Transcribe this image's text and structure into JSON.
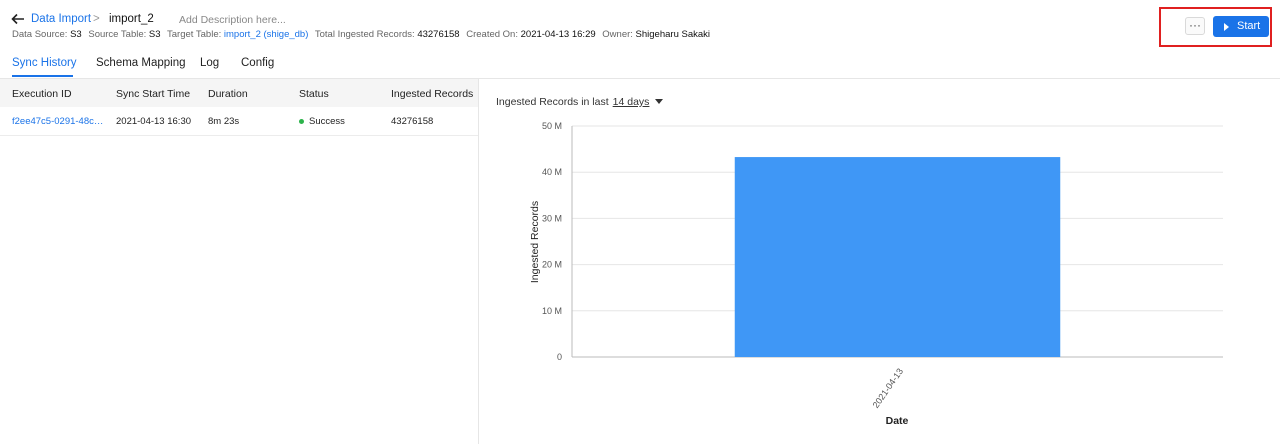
{
  "header": {
    "breadcrumb_link": "Data Import",
    "breadcrumb_sep": ">",
    "import_name": "import_2",
    "description_placeholder": "Add Description here...",
    "meta": {
      "data_source_label": "Data Source:",
      "data_source_value": "S3",
      "source_table_label": "Source Table:",
      "source_table_value": "S3",
      "target_table_label": "Target Table:",
      "target_table_value": "import_2 (shige_db)",
      "total_label": "Total Ingested Records:",
      "total_value": "43276158",
      "created_label": "Created On:",
      "created_value": "2021-04-13 16:29",
      "owner_label": "Owner:",
      "owner_value": "Shigeharu Sakaki"
    },
    "more_label": "···",
    "start_label": "Start"
  },
  "tabs": [
    {
      "label": "Sync History",
      "active": true
    },
    {
      "label": "Schema Mapping",
      "active": false
    },
    {
      "label": "Log",
      "active": false
    },
    {
      "label": "Config",
      "active": false
    }
  ],
  "table": {
    "columns": [
      "Execution ID",
      "Sync Start Time",
      "Duration",
      "Status",
      "Ingested Records"
    ],
    "rows": [
      {
        "execution_id": "f2ee47c5-0291-48c…",
        "start_time": "2021-04-13 16:30",
        "duration": "8m 23s",
        "status": "Success",
        "records": "43276158"
      }
    ]
  },
  "chart": {
    "title_prefix": "Ingested Records in last",
    "range_label": "14 days"
  },
  "chart_data": {
    "type": "bar",
    "categories": [
      "2021-04-13"
    ],
    "values": [
      43276158
    ],
    "xlabel": "Date",
    "ylabel": "Ingested Records",
    "ylim": [
      0,
      50000000
    ],
    "yticks": [
      "0",
      "10 M",
      "20 M",
      "30 M",
      "40 M",
      "50 M"
    ],
    "bar_color": "#3f97f6",
    "grid": true
  },
  "colors": {
    "accent": "#1a73e8",
    "success": "#2bb34a",
    "highlight": "#e02020"
  }
}
